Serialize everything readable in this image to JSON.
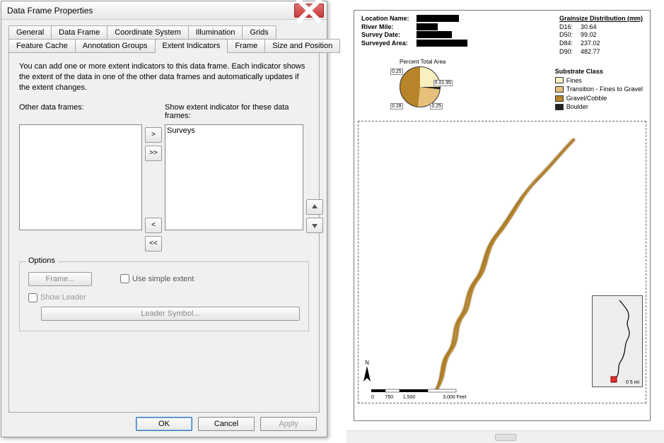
{
  "dialog": {
    "title": "Data Frame Properties",
    "tabs_row1": [
      "General",
      "Data Frame",
      "Coordinate System",
      "Illumination",
      "Grids"
    ],
    "tabs_row2": [
      "Feature Cache",
      "Annotation Groups",
      "Extent Indicators",
      "Frame",
      "Size and Position"
    ],
    "active_tab": "Extent Indicators",
    "desc": "You can add one or more extent indicators to this data frame.  Each indicator shows the extent of the data in one of the other data frames and automatically updates if the extent changes.",
    "other_label": "Other data frames:",
    "show_label": "Show extent indicator for these data frames:",
    "other_items": [],
    "show_items": [
      "Surveys"
    ],
    "options_legend": "Options",
    "frame_btn": "Frame...",
    "use_simple": "Use simple extent",
    "show_leader": "Show Leader",
    "leader_symbol": "Leader Symbol...",
    "ok": "OK",
    "cancel": "Cancel",
    "apply": "Apply"
  },
  "report": {
    "loc_name_lab": "Location Name:",
    "river_mile_lab": "River Mile:",
    "survey_date_lab": "Survey Date:",
    "surveyed_area_lab": "Surveyed Area:",
    "grainsize_title": "Grainsize Distribution (mm)",
    "d16_lab": "D16:",
    "d16": "30.64",
    "d50_lab": "D50:",
    "d50": "99.02",
    "d84_lab": "D84:",
    "d84": "237.02",
    "d90_lab": "D90:",
    "d90": "482.77",
    "substrate_title": "Substrate Class",
    "fines": "Fines",
    "transition": "Transition - Fines to Gravel",
    "gravel": "Gravel/Cobble",
    "boulder": "Boulder",
    "pie_title": "Percent Total Area",
    "scale_ticks": "0        750       1,500                    3,000 Feet",
    "inset_scale": "0   5 mi",
    "north": "N"
  },
  "chart_data": {
    "type": "pie",
    "title": "Percent Total Area",
    "categories": [
      "Fines",
      "Boulder",
      "Transition - Fines to Gravel",
      "Gravel/Cobble"
    ],
    "values": [
      0.25,
      0.02,
      0.25,
      0.48
    ],
    "labels": [
      "0.25",
      "0.01.95",
      "0.25",
      "0.28"
    ],
    "colors": [
      "#f9f0c0",
      "#202020",
      "#e6c07a",
      "#b8842a"
    ]
  }
}
